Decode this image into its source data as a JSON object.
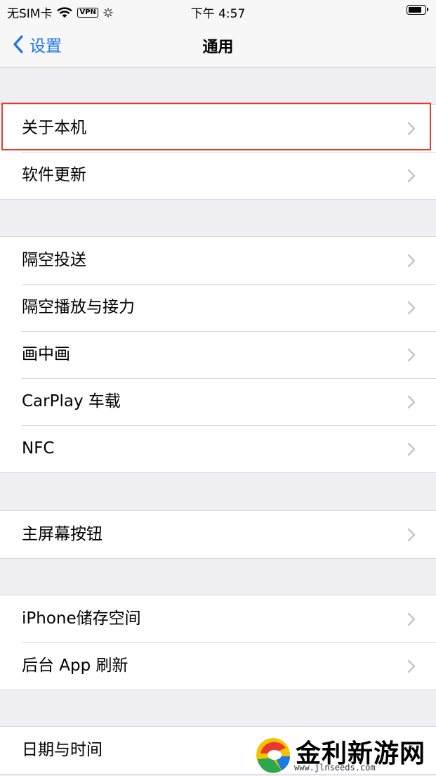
{
  "status_bar": {
    "carrier": "无SIM卡",
    "vpn": "VPN",
    "time": "下午 4:57",
    "battery_level": 0.85
  },
  "nav": {
    "back_label": "设置",
    "title": "通用"
  },
  "groups": [
    {
      "items": [
        {
          "label": "关于本机",
          "highlighted": true
        },
        {
          "label": "软件更新"
        }
      ]
    },
    {
      "items": [
        {
          "label": "隔空投送"
        },
        {
          "label": "隔空播放与接力"
        },
        {
          "label": "画中画"
        },
        {
          "label": "CarPlay 车载"
        },
        {
          "label": "NFC"
        }
      ]
    },
    {
      "items": [
        {
          "label": "主屏幕按钮"
        }
      ]
    },
    {
      "items": [
        {
          "label": "iPhone储存空间"
        },
        {
          "label": "后台 App 刷新"
        }
      ]
    },
    {
      "items": [
        {
          "label": "日期与时间"
        }
      ]
    }
  ],
  "watermark": {
    "name": "金利新游网",
    "url": "www.jlnseeds.com"
  },
  "colors": {
    "accent": "#1a73e8",
    "highlight_border": "#e8392f"
  }
}
